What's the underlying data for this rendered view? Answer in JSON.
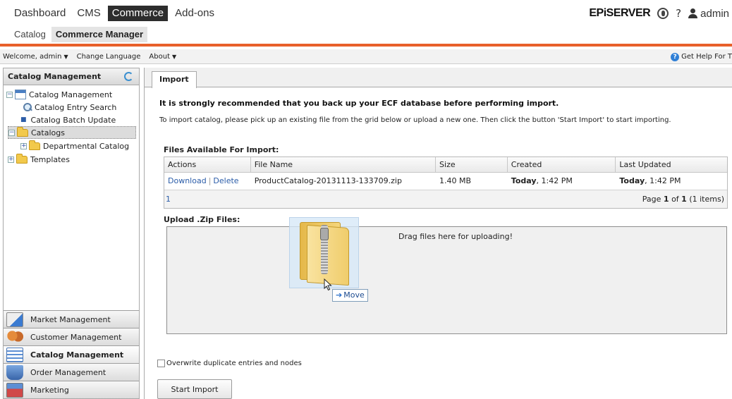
{
  "topnav": {
    "menu1": [
      {
        "label": "Dashboard",
        "active": false
      },
      {
        "label": "CMS",
        "active": false
      },
      {
        "label": "Commerce",
        "active": true
      },
      {
        "label": "Add-ons",
        "active": false
      }
    ],
    "menu2": [
      {
        "label": "Catalog",
        "active": false
      },
      {
        "label": "Commerce Manager",
        "active": true
      }
    ],
    "brand": "EPiSERVER",
    "help_glyph": "?",
    "user": "admin",
    "accent_color": "#e8602a"
  },
  "welcomebar": {
    "welcome": "Welcome, admin",
    "change_language": "Change Language",
    "about": "About",
    "help": "Get Help For T",
    "help_icon": "?"
  },
  "left": {
    "header": "Catalog Management",
    "tree": [
      {
        "label": "Catalog Management",
        "icon": "calendar-icon"
      },
      {
        "label": "Catalog Entry Search",
        "icon": "search-icon"
      },
      {
        "label": "Catalog Batch Update",
        "icon": "bullet-icon"
      },
      {
        "label": "Catalogs",
        "icon": "folder-icon"
      },
      {
        "label": "Departmental Catalog",
        "icon": "folder-icon"
      },
      {
        "label": "Templates",
        "icon": "folder-icon"
      }
    ],
    "accordion": [
      {
        "label": "Market Management",
        "icon": "market-icon"
      },
      {
        "label": "Customer Management",
        "icon": "customer-icon"
      },
      {
        "label": "Catalog Management",
        "icon": "catalog-icon"
      },
      {
        "label": "Order Management",
        "icon": "order-icon"
      },
      {
        "label": "Marketing",
        "icon": "marketing-icon"
      }
    ]
  },
  "main": {
    "tab": "Import",
    "warning": "It is strongly recommended that you back up your ECF database before performing import.",
    "instructions": "To import catalog, please pick up an existing file from the grid below or upload a new one. Then click the button 'Start Import' to start importing.",
    "files_title": "Files Available For Import:",
    "grid": {
      "columns": [
        "Actions",
        "File Name",
        "Size",
        "Created",
        "Last Updated"
      ],
      "rows": [
        {
          "download": "Download",
          "delete": "Delete",
          "file_name": "ProductCatalog-20131113-133709.zip",
          "size": "1.40 MB",
          "created_day": "Today",
          "created_time": ", 1:42 PM",
          "updated_day": "Today",
          "updated_time": ", 1:42 PM"
        }
      ],
      "pager": {
        "page_link": "1",
        "page_word": "Page",
        "current": "1",
        "of_word": "of",
        "total": "1",
        "items": "(1 items)"
      }
    },
    "upload_title": "Upload .Zip Files:",
    "drop_text": "Drag files here for uploading!",
    "move_label": "Move",
    "overwrite_label": "Overwrite duplicate entries and nodes",
    "start_button": "Start Import"
  }
}
